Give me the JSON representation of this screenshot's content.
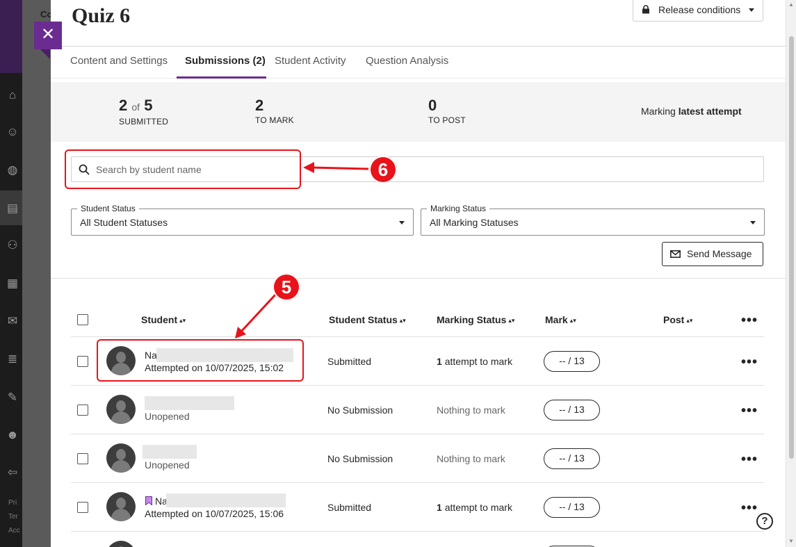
{
  "page": {
    "title": "Quiz 6",
    "release_conditions_label": "Release conditions",
    "backdrop_text": "Co"
  },
  "tabs": [
    {
      "label": "Content and Settings"
    },
    {
      "label": "Submissions (2)"
    },
    {
      "label": "Student Activity"
    },
    {
      "label": "Question Analysis"
    }
  ],
  "stats": {
    "submitted": {
      "value": "2",
      "of": "of",
      "total": "5",
      "label": "SUBMITTED"
    },
    "to_mark": {
      "value": "2",
      "label": "TO MARK"
    },
    "to_post": {
      "value": "0",
      "label": "TO POST"
    },
    "marking_prefix": "Marking",
    "marking_strong": "latest attempt"
  },
  "search": {
    "placeholder": "Search by student name"
  },
  "filters": {
    "student_status": {
      "legend": "Student Status",
      "value": "All Student Statuses"
    },
    "marking_status": {
      "legend": "Marking Status",
      "value": "All Marking Statuses"
    }
  },
  "send_message_label": "Send Message",
  "table": {
    "headers": {
      "student": "Student",
      "student_status": "Student Status",
      "marking_status": "Marking Status",
      "mark": "Mark",
      "post": "Post"
    },
    "rows": [
      {
        "name": "Na",
        "sub": "Attempted on 10/07/2025, 15:02",
        "status": "Submitted",
        "marking_count": "1",
        "marking_text": "attempt to mark",
        "mark": "--  / 13"
      },
      {
        "name": "",
        "sub": "Unopened",
        "status": "No Submission",
        "marking_count": "",
        "marking_text": "Nothing to mark",
        "mark": "--  / 13"
      },
      {
        "name": "",
        "sub": "Unopened",
        "status": "No Submission",
        "marking_count": "",
        "marking_text": "Nothing to mark",
        "mark": "--  / 13"
      },
      {
        "name": "Na",
        "sub": "Attempted on 10/07/2025, 15:06",
        "status": "Submitted",
        "marking_count": "1",
        "marking_text": "attempt to mark",
        "mark": "--  / 13"
      }
    ]
  },
  "help_label": "?",
  "rail": {
    "footer_lines": [
      "Pri",
      "Ter",
      "Acc"
    ]
  },
  "annotations": {
    "callout_5": "5",
    "callout_6": "6"
  },
  "colors": {
    "accent": "#6a2c91",
    "annotation": "#e8131a"
  }
}
